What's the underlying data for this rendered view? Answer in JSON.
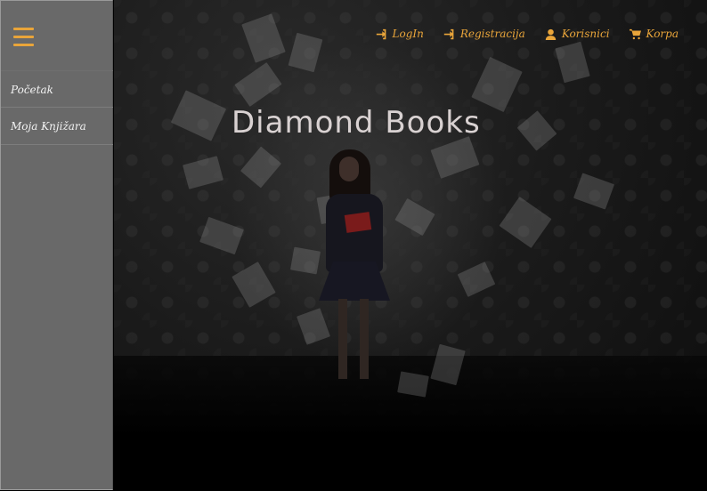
{
  "sidebar": {
    "items": [
      {
        "label": "Početak"
      },
      {
        "label": "Moja Knjižara"
      }
    ]
  },
  "header": {
    "links": [
      {
        "label": "LogIn",
        "icon": "sign-in-icon"
      },
      {
        "label": "Registracija",
        "icon": "sign-in-icon"
      },
      {
        "label": "Korisnici",
        "icon": "user-icon"
      },
      {
        "label": "Korpa",
        "icon": "cart-icon"
      }
    ]
  },
  "hero": {
    "title": "Diamond Books"
  },
  "colors": {
    "accent": "#e9a53a",
    "sidebar_bg": "#696969",
    "title": "#d9d2d2"
  }
}
